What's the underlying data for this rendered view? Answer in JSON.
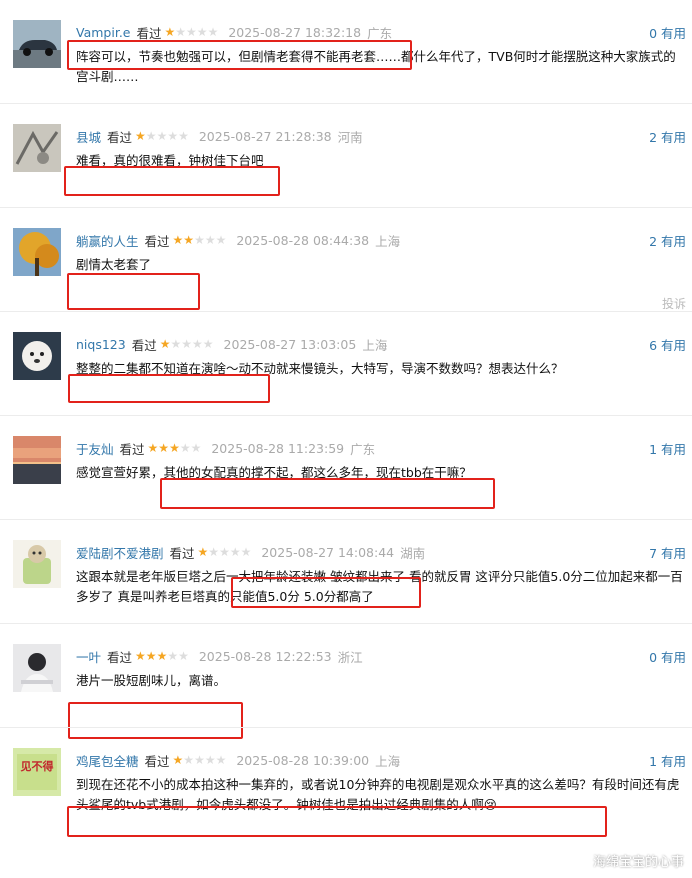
{
  "watermark": "海绵宝宝的心事",
  "report_label": "投诉",
  "colors": {
    "username": "#3377aa",
    "highlight": "#e2221b",
    "star_on": "#f5a623",
    "star_off": "#dddddd",
    "meta_gray": "#aaaaaa"
  },
  "comments": [
    {
      "user": "Vampir.e",
      "seen": "看过",
      "rating": 1,
      "time": "2025-08-27 18:32:18",
      "location": "广东",
      "useful": "0 有用",
      "text": "阵容可以，节奏也勉强可以，但剧情老套得不能再老套……都什么年代了，TVB何时才能摆脱这种大家族式的宫斗剧……",
      "avatar": "car-photo-avatar"
    },
    {
      "user": "县城",
      "seen": "看过",
      "rating": 1,
      "time": "2025-08-27 21:28:38",
      "location": "河南",
      "useful": "2 有用",
      "text": "难看，真的很难看，钟树佳下台吧",
      "avatar": "sketch-avatar"
    },
    {
      "user": "躺赢的人生",
      "seen": "看过",
      "rating": 2,
      "time": "2025-08-28 08:44:38",
      "location": "上海",
      "useful": "2 有用",
      "text": "剧情太老套了",
      "avatar": "autumn-tree-avatar"
    },
    {
      "user": "niqs123",
      "seen": "看过",
      "rating": 1,
      "time": "2025-08-27 13:03:05",
      "location": "上海",
      "useful": "6 有用",
      "text": "整整的二集都不知道在演啥～动不动就来慢镜头，大特写，导演不数数吗？想表达什么？",
      "avatar": "white-dog-avatar"
    },
    {
      "user": "于友灿",
      "seen": "看过",
      "rating": 3,
      "time": "2025-08-28 11:23:59",
      "location": "广东",
      "useful": "1 有用",
      "text": "感觉宣萱好累，其他的女配真的撑不起，都这么多年，现在tbb在干嘛？",
      "avatar": "sunset-avatar"
    },
    {
      "user": "爱陆剧不爱港剧",
      "seen": "看过",
      "rating": 1,
      "time": "2025-08-27 14:08:44",
      "location": "湖南",
      "useful": "7 有用",
      "text": "这跟本就是老年版巨塔之后一大把年龄还装嫩 皱纹都出来了 看的就反胃 这评分只能值5.0分二位加起来都一百多岁了 真是叫养老巨塔真的只能值5.0分 5.0分都高了",
      "avatar": "cartoon-avatar"
    },
    {
      "user": "一叶",
      "seen": "看过",
      "rating": 3,
      "time": "2025-08-28 12:22:53",
      "location": "浙江",
      "useful": "0 有用",
      "text": "港片一股短剧味儿，离谱。",
      "avatar": "person-avatar"
    },
    {
      "user": "鸡尾包全糖",
      "seen": "看过",
      "rating": 1,
      "time": "2025-08-28 10:39:00",
      "location": "上海",
      "useful": "1 有用",
      "text": "到现在还花不小的成本拍这种一集弃的，或者说10分钟弃的电视剧是观众水平真的这么差吗？有段时间还有虎头鲨尾的tvb式港剧，如今虎头都没了。钟树佳也是拍出过经典剧集的人啊😢",
      "avatar": "green-logo-avatar"
    }
  ]
}
